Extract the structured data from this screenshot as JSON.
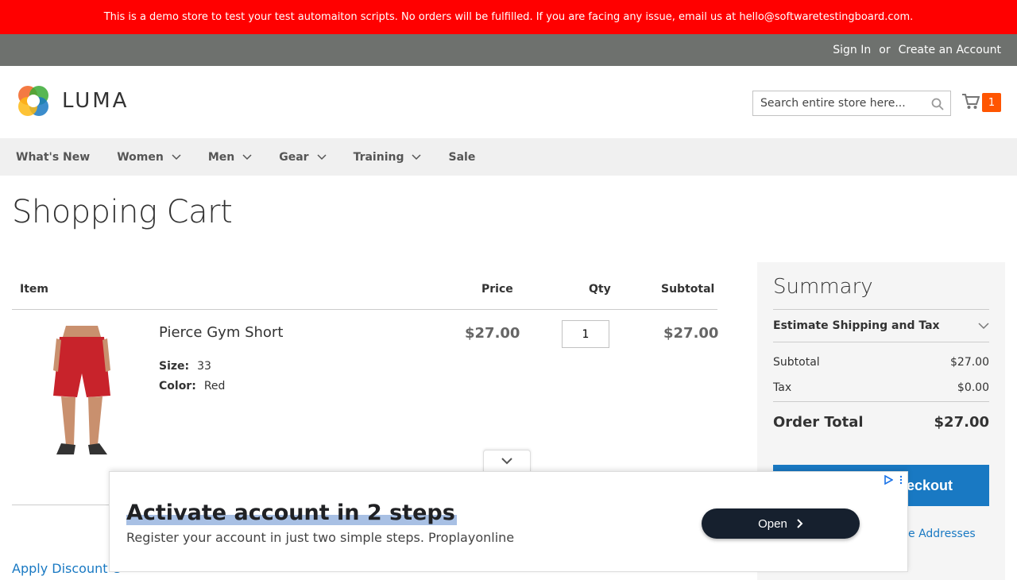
{
  "demo_notice": "This is a demo store to test your test automaiton scripts. No orders will be fulfilled. If you are facing any issue, email us at hello@softwaretestingboard.com.",
  "top_links": {
    "sign_in": "Sign In",
    "or": "or",
    "create_account": "Create an Account"
  },
  "logo": {
    "text": "LUMA"
  },
  "search": {
    "placeholder": "Search entire store here..."
  },
  "cart": {
    "count": "1"
  },
  "nav": [
    "What's New",
    "Women",
    "Men",
    "Gear",
    "Training",
    "Sale"
  ],
  "page_title": "Shopping Cart",
  "table": {
    "headers": {
      "item": "Item",
      "price": "Price",
      "qty": "Qty",
      "subtotal": "Subtotal"
    },
    "rows": [
      {
        "name": "Pierce Gym Short",
        "options": [
          {
            "label": "Size:",
            "value": "33"
          },
          {
            "label": "Color:",
            "value": "Red"
          }
        ],
        "price": "$27.00",
        "qty": "1",
        "subtotal": "$27.00"
      }
    ]
  },
  "discount_link": "Apply Discount C",
  "summary": {
    "title": "Summary",
    "estimate": "Estimate Shipping and Tax",
    "subtotal_label": "Subtotal",
    "subtotal_value": "$27.00",
    "tax_label": "Tax",
    "tax_value": "$0.00",
    "total_label": "Order Total",
    "total_value": "$27.00",
    "checkout_label": "eckout",
    "multi_label": "e Addresses"
  },
  "ad": {
    "title": "Activate account in 2 steps",
    "description": "Register your account in just two simple steps. Proplayonline",
    "button": "Open"
  },
  "colors": {
    "demo_bar": "#ff0000",
    "accent": "#1979c3",
    "cart_badge": "#ff5501"
  }
}
